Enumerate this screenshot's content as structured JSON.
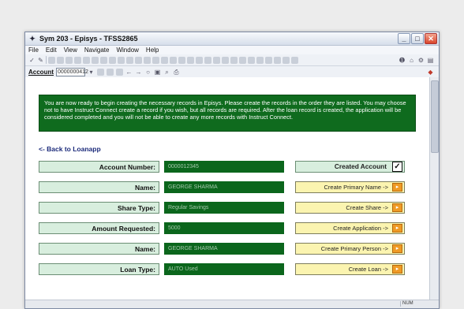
{
  "window": {
    "title": "Sym 203 - Episys - TFSS2865",
    "controls": [
      "_",
      "□",
      "✕"
    ]
  },
  "menu": [
    "File",
    "Edit",
    "View",
    "Navigate",
    "Window",
    "Help"
  ],
  "account_bar": {
    "label": "Account",
    "value": "0000000412"
  },
  "banner": {
    "text": "You are now ready to begin creating the necessary records in Episys. Please create the records in the order they are listed. You may choose not to have Instruct Connect create a record if you wish, but all records are required. After the loan record is created, the application will be considered completed and you will not be able to create any more records with Instruct Connect."
  },
  "back_link": "<- Back to Loanapp",
  "rows": [
    {
      "label": "Account Number:",
      "value": "0000012345",
      "action": "Created Account"
    },
    {
      "label": "Name:",
      "value": "GEORGE SHARMA",
      "action": "Create Primary Name ->"
    },
    {
      "label": "Share Type:",
      "value": "Regular Savings",
      "action": "Create Share ->"
    },
    {
      "label": "Amount Requested:",
      "value": "5000",
      "action": "Create Application ->"
    },
    {
      "label": "Name:",
      "value": "GEORGE SHARMA",
      "action": "Create Primary Person ->"
    },
    {
      "label": "Loan Type:",
      "value": "AUTO Used",
      "action": "Create Loan ->"
    }
  ],
  "status": {
    "pane": "NUM"
  },
  "colors": {
    "banner": "#0f6b1e",
    "label_bg": "#d8eede",
    "value_bg": "#0b661c",
    "action_bg": "#fbf4b0",
    "go_button": "#ef9a25"
  },
  "icons": {
    "check": "checkbox-checked-icon",
    "go": "go-arrow-icon"
  }
}
